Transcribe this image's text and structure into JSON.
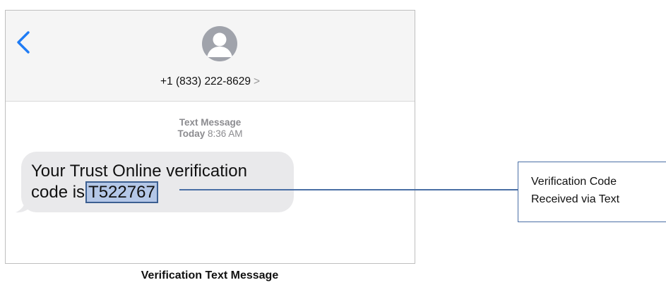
{
  "conversation": {
    "back_icon": "chevron-left-icon",
    "avatar_icon": "person-icon",
    "contact_number": "+1 (833) 222-8629",
    "contact_chevron": ">",
    "message_type": "Text Message",
    "date_day": "Today",
    "date_time": "8:36 AM",
    "message": {
      "line1": "Your Trust Online verification",
      "line2_prefix": "code is",
      "code": "T522767"
    }
  },
  "callout": {
    "line1": "Verification Code",
    "line2": "Received via Text"
  },
  "caption": "Verification Text Message",
  "colors": {
    "accent_blue": "#1f7cf5",
    "highlight_fill": "#b4c7e7",
    "highlight_border": "#3c5f91",
    "connector": "#4a6fa5",
    "bubble": "#e9e9eb",
    "avatar": "#a0a3ab"
  }
}
